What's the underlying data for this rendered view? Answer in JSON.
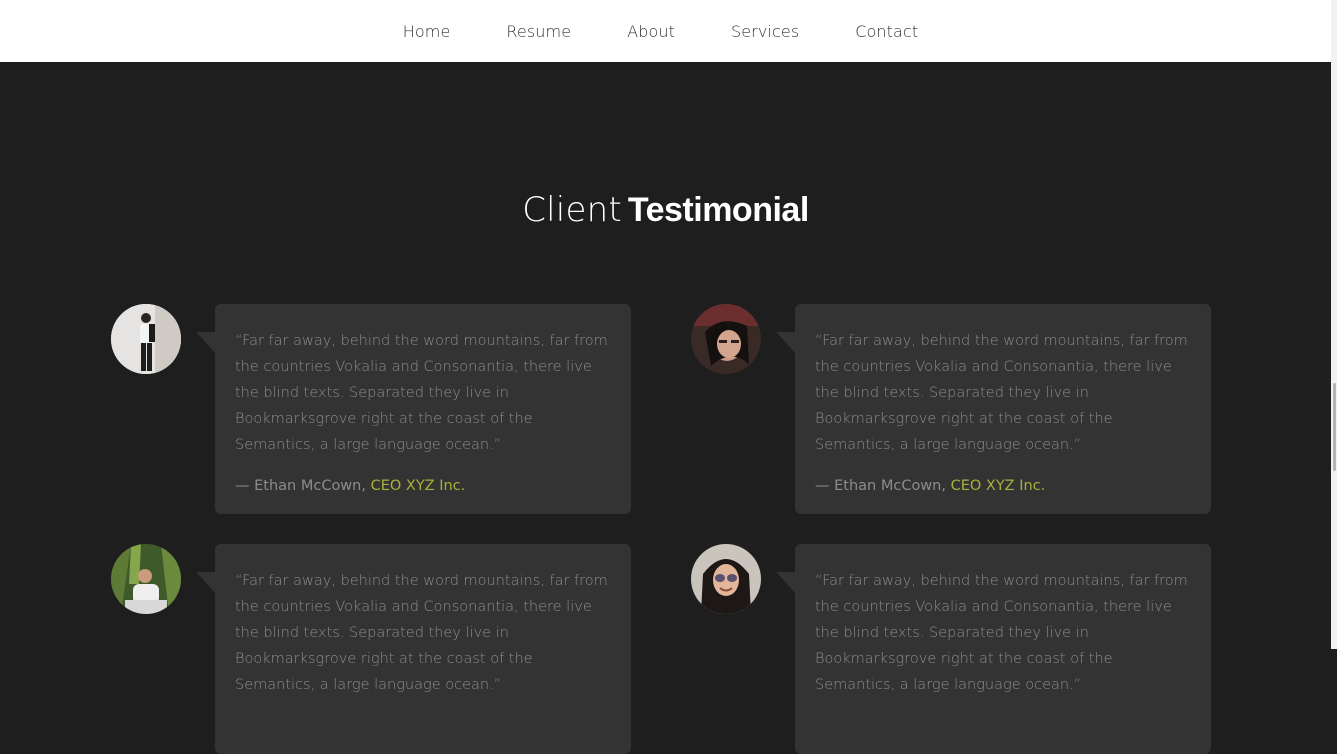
{
  "nav": {
    "items": [
      "Home",
      "Resume",
      "About",
      "Services",
      "Contact"
    ]
  },
  "section": {
    "title_light": "Client",
    "title_bold": "Testimonial"
  },
  "testimonials": [
    {
      "quote": "“Far far away, behind the word mountains, far from the countries Vokalia and Consonantia, there live the blind texts. Separated they live in Bookmarksgrove right at the coast of the Semantics, a large language ocean.”",
      "author": "— Ethan McCown,",
      "company": "CEO XYZ Inc."
    },
    {
      "quote": "“Far far away, behind the word mountains, far from the countries Vokalia and Consonantia, there live the blind texts. Separated they live in Bookmarksgrove right at the coast of the Semantics, a large language ocean.”",
      "author": "— Ethan McCown,",
      "company": "CEO XYZ Inc."
    },
    {
      "quote": "“Far far away, behind the word mountains, far from the countries Vokalia and Consonantia, there live the blind texts. Separated they live in Bookmarksgrove right at the coast of the Semantics, a large language ocean.”",
      "author": "",
      "company": ""
    },
    {
      "quote": "“Far far away, behind the word mountains, far from the countries Vokalia and Consonantia, there live the blind texts. Separated they live in Bookmarksgrove right at the coast of the Semantics, a large language ocean.”",
      "author": "",
      "company": ""
    }
  ],
  "colors": {
    "background": "#1e1e1e",
    "card": "#333333",
    "text_muted": "#8c8c8c",
    "accent": "#a7b13a",
    "nav_bg": "#ffffff"
  }
}
